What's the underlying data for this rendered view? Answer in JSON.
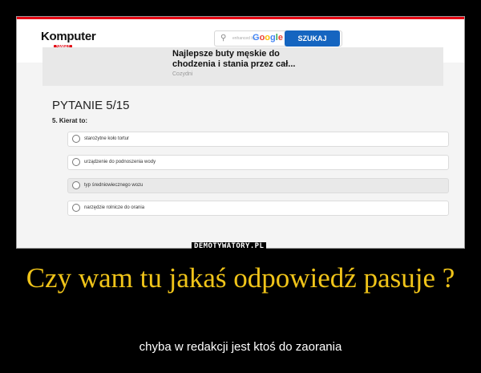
{
  "screenshot": {
    "logo": {
      "text": "Komputer",
      "badge": "ŚWIAT"
    },
    "search": {
      "enhanced_by": "enhanced by",
      "google": "Google",
      "button_label": "SZUKAJ"
    },
    "ad": {
      "title": "Najlepsze buty męskie do chodzenia i stania przez cał...",
      "source": "Cozydni"
    },
    "quiz": {
      "progress": "PYTANIE 5/15",
      "question": "5. Kierat to:",
      "answers": [
        {
          "label": "starożytne koło tortur",
          "highlighted": false
        },
        {
          "label": "urządzenie do podnoszenia wody",
          "highlighted": false
        },
        {
          "label": "typ średniowiecznego wozu",
          "highlighted": true
        },
        {
          "label": "narzędzie rolnicze do orania",
          "highlighted": false
        }
      ]
    }
  },
  "watermark": "DEMOTYWATORY.PL",
  "title": "Czy wam tu jakaś odpowiedź pasuje ?",
  "subtitle": "chyba w redakcji jest ktoś do zaorania",
  "colors": {
    "accent_red": "#e30613",
    "button_blue": "#1565c0",
    "title_yellow": "#f0c419"
  }
}
